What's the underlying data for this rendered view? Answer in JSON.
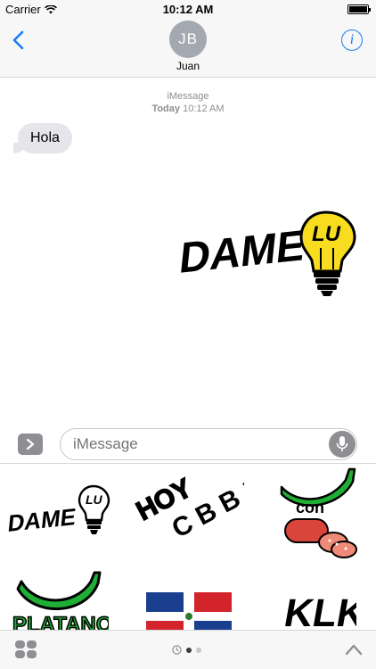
{
  "status_bar": {
    "carrier": "Carrier",
    "time": "10:12 AM"
  },
  "nav": {
    "avatar_initials": "JB",
    "contact_name": "Juan",
    "info_glyph": "i"
  },
  "conversation": {
    "service": "iMessage",
    "day": "Today",
    "time": "10:12 AM",
    "messages": [
      {
        "text": "Hola",
        "direction": "incoming"
      }
    ],
    "sent_sticker": {
      "text_a": "DAME",
      "text_b": "LU"
    }
  },
  "input": {
    "placeholder": "iMessage"
  },
  "stickers": [
    {
      "name": "dame-lu",
      "text_a": "DAME",
      "text_b": "LU"
    },
    {
      "name": "hoy-cbb",
      "line1": "HOY",
      "line2": "C B B !!"
    },
    {
      "name": "platano-con-salami",
      "text": "con"
    },
    {
      "name": "platano",
      "text": "PLATANO"
    },
    {
      "name": "dominican-flag"
    },
    {
      "name": "klk",
      "text": "KLK"
    }
  ],
  "colors": {
    "accent": "#1a7cf5",
    "bubble": "#e5e5ea",
    "banana": "#1fae36",
    "bulb": "#f7dc1f"
  }
}
